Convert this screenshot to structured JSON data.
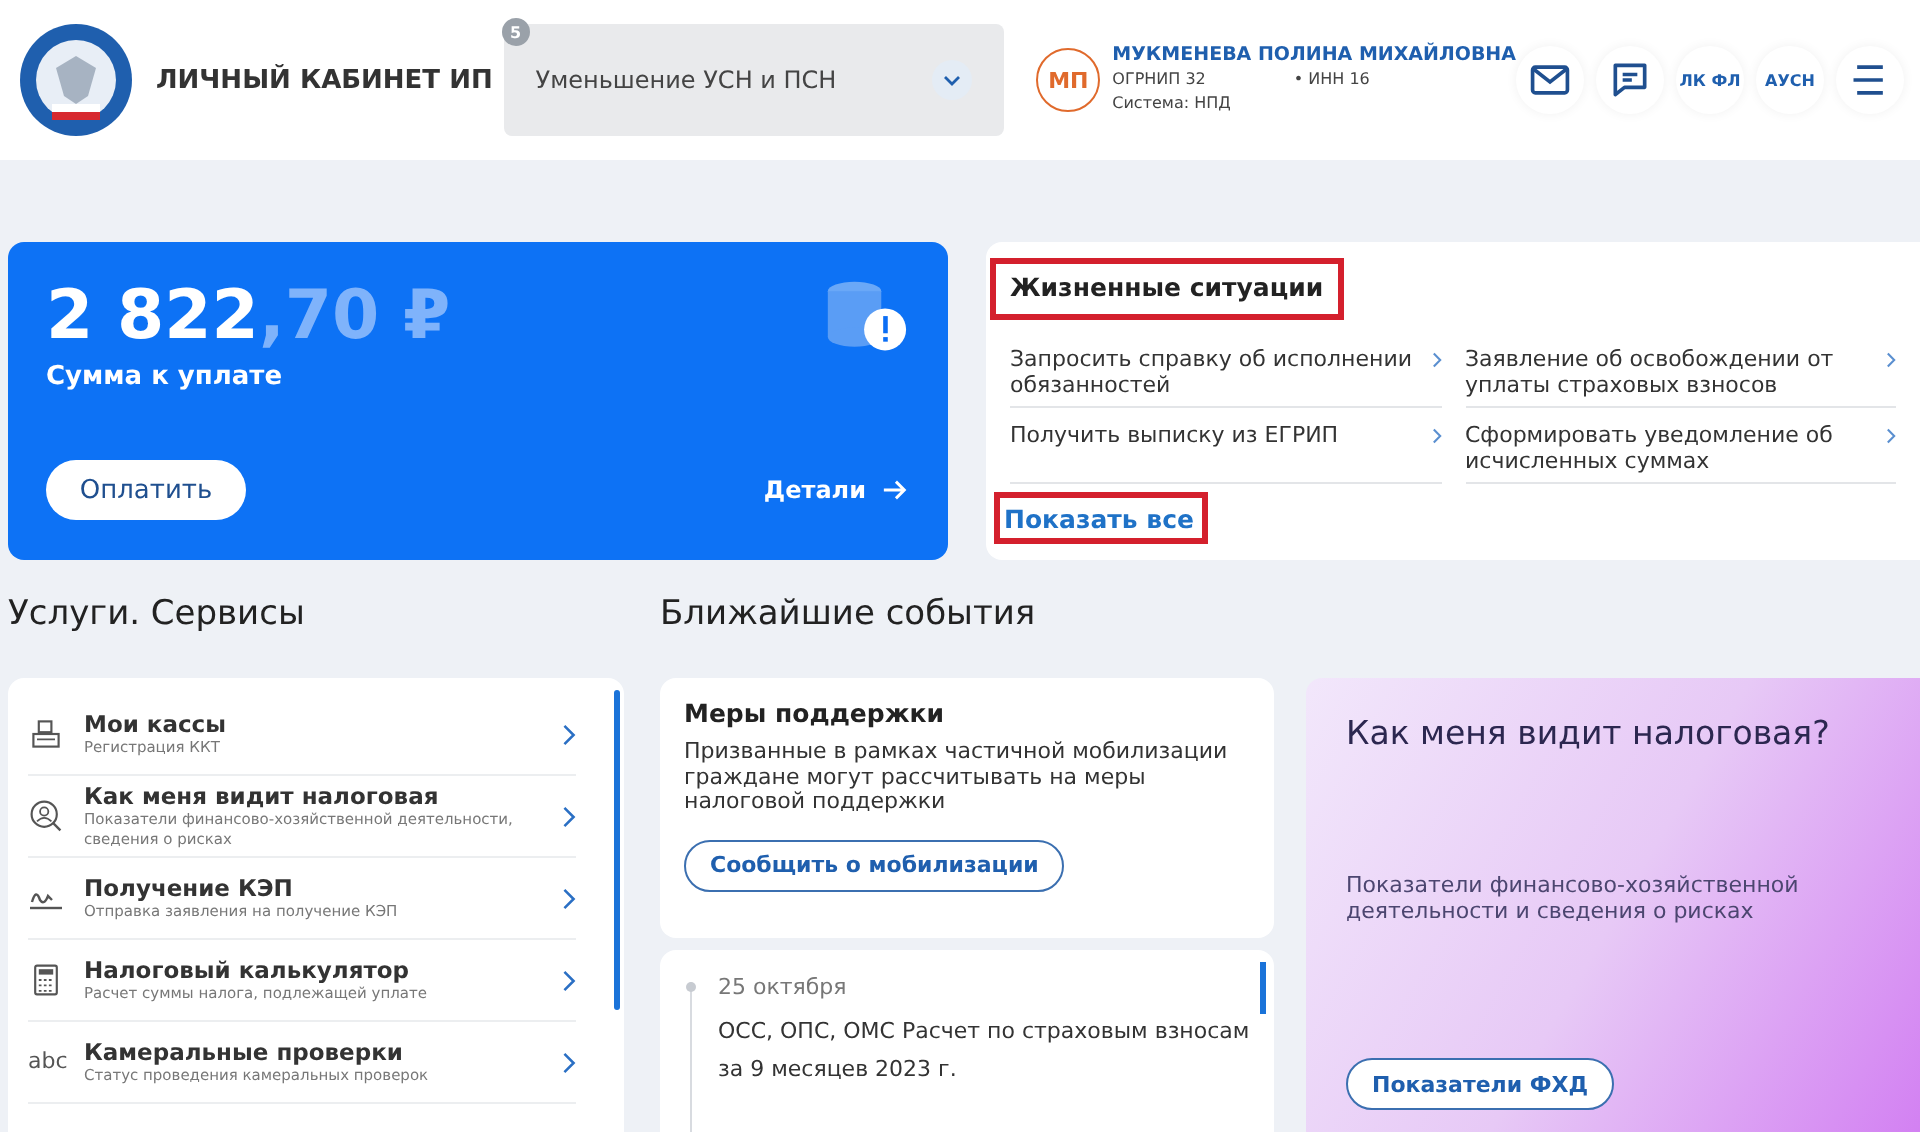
{
  "header": {
    "title": "ЛИЧНЫЙ КАБИНЕТ ИП",
    "selector": {
      "badge": "5",
      "value": "Уменьшение УСН и ПСН"
    },
    "user": {
      "initials": "МП",
      "name": "МУКМЕНЕВА ПОЛИНА МИХАЙЛОВНА",
      "ogrnip": "ОГРНИП 32",
      "inn": "• ИНН 16",
      "system": "Система: НПД"
    },
    "buttons": [
      {
        "kind": "mail"
      },
      {
        "kind": "chat"
      },
      {
        "kind": "text",
        "label": "ЛК ФЛ"
      },
      {
        "kind": "text",
        "label": "АУСН"
      },
      {
        "kind": "menu"
      }
    ]
  },
  "payment": {
    "amount_main": "2 822",
    "amount_fraction": ",70 ₽",
    "caption": "Сумма к уплате",
    "pay_button": "Оплатить",
    "details_link": "Детали"
  },
  "life_situations": {
    "title": "Жизненные ситуации",
    "highlighted": true,
    "items": [
      {
        "label": "Запросить справку об исполнении обязанностей"
      },
      {
        "label": "Заявление об освобождении от уплаты страховых взносов"
      },
      {
        "label": "Получить выписку из ЕГРИП"
      },
      {
        "label": "Сформировать уведомление об исчисленных суммах"
      }
    ],
    "show_all": "Показать все",
    "show_all_highlighted": true
  },
  "services": {
    "title": "Услуги. Сервисы",
    "items": [
      {
        "kind": "register",
        "title": "Мои кассы",
        "subtitle": "Регистрация ККТ"
      },
      {
        "kind": "person",
        "title": "Как меня видит налоговая",
        "subtitle": "Показатели финансово-хозяйственной деятельности, сведения о рисках"
      },
      {
        "kind": "signature",
        "title": "Получение КЭП",
        "subtitle": "Отправка заявления на получение КЭП"
      },
      {
        "kind": "calculator",
        "title": "Налоговый калькулятор",
        "subtitle": "Расчет суммы налога, подлежащей уплате"
      },
      {
        "kind": "text",
        "icon_text": "abc",
        "title": "Камеральные проверки",
        "subtitle": "Статус проведения камеральных проверок"
      }
    ]
  },
  "events": {
    "title": "Ближайшие события",
    "support": {
      "title": "Меры поддержки",
      "text": "Призванные в рамках частичной мобилизации граждане могут рассчитывать на меры налоговой поддержки",
      "button": "Сообщить о мобилизации"
    },
    "timeline": [
      {
        "date": "25 октября",
        "text": "ОСС, ОПС, ОМС Расчет по страховым взносам за 9 месяцев 2023 г."
      }
    ]
  },
  "promo": {
    "title": "Как меня видит налоговая?",
    "text": "Показатели финансово-хозяйственной деятельности и сведения о рисках",
    "button": "Показатели ФХД"
  }
}
